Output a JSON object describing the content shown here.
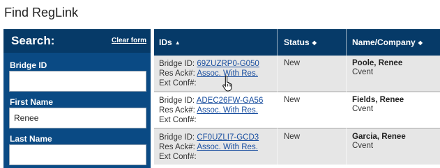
{
  "page": {
    "title": "Find RegLink"
  },
  "search": {
    "title": "Search:",
    "clear_label": "Clear form",
    "fields": [
      {
        "label": "Bridge ID",
        "value": ""
      },
      {
        "label": "First Name",
        "value": "Renee"
      },
      {
        "label": "Last Name",
        "value": ""
      }
    ]
  },
  "table": {
    "headers": [
      {
        "label": "IDs",
        "sort": "▲"
      },
      {
        "label": "Status",
        "sort": "◆"
      },
      {
        "label": "Name/Company",
        "sort": "◆"
      }
    ],
    "label_bridge": "Bridge ID:",
    "label_resack": "Res Ack#:",
    "label_extconf": "Ext Conf#:",
    "rows": [
      {
        "bridge_id": "69ZUZRP0-G050",
        "res_ack": "Assoc. With Res.",
        "ext_conf": "",
        "status": "New",
        "name": "Poole, Renee",
        "company": "Cvent"
      },
      {
        "bridge_id": "ADEC26FW-GA56",
        "res_ack": "Assoc. With Res.",
        "ext_conf": "",
        "status": "New",
        "name": "Fields, Renee",
        "company": "Cvent"
      },
      {
        "bridge_id": "CF0UZLI7-GCD3",
        "res_ack": "Assoc. With Res.",
        "ext_conf": "",
        "status": "New",
        "name": "Garcia, Renee",
        "company": "Cvent"
      }
    ]
  },
  "colors": {
    "header_dark": "#063a68",
    "panel_blue": "#0a4a84",
    "link": "#1a4fa0",
    "row_alt": "#e6e6e6"
  },
  "icons": {
    "cursor": "hand-pointer-icon"
  }
}
